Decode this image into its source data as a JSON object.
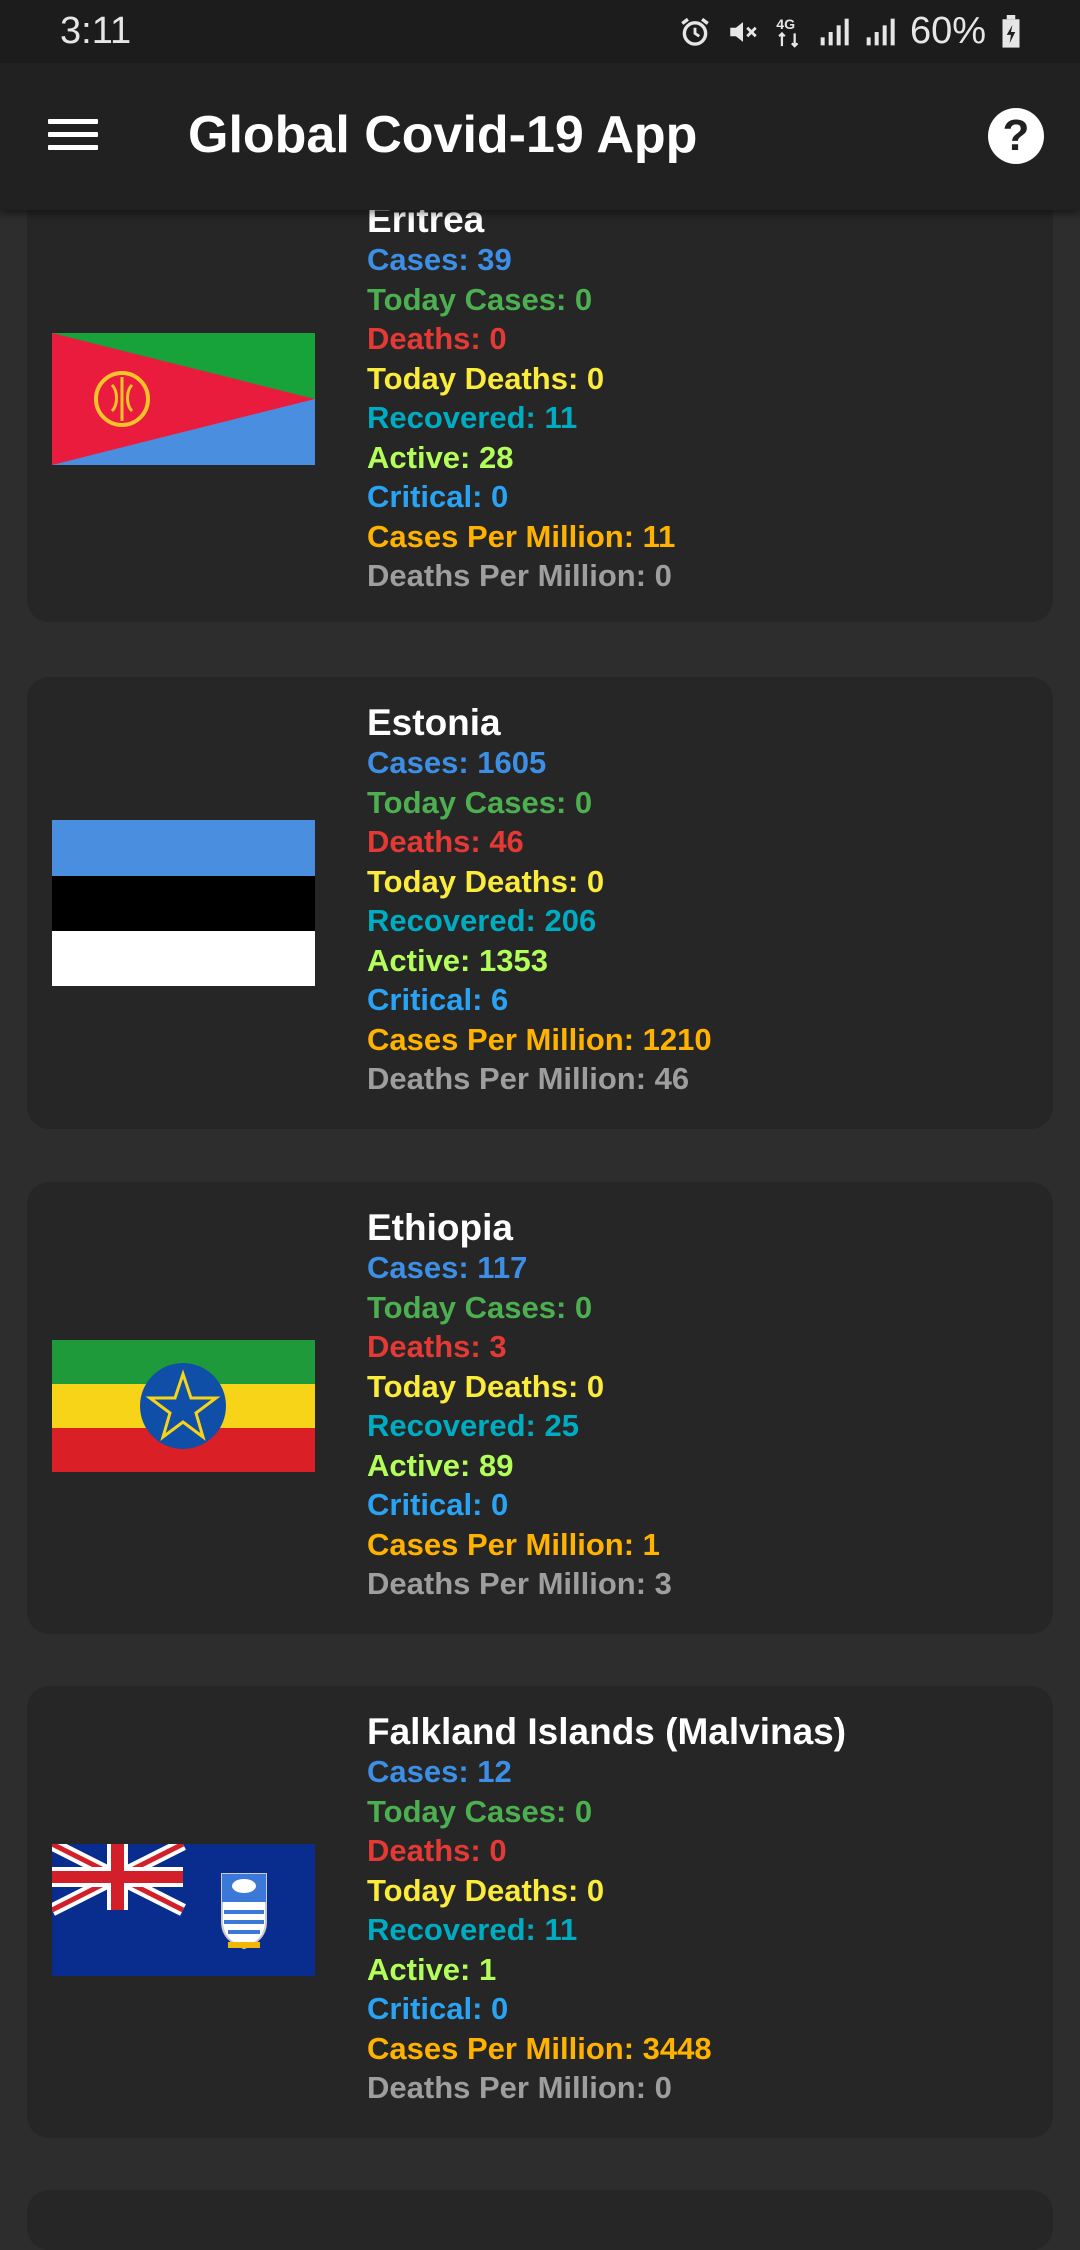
{
  "status_bar": {
    "time": "3:11",
    "battery": "60%",
    "network": "4G"
  },
  "app_bar": {
    "title": "Global Covid-19 App",
    "menu_icon": "menu-icon",
    "help_icon": "help-icon"
  },
  "labels": {
    "cases": "Cases: ",
    "today_cases": "Today Cases: ",
    "deaths": "Deaths: ",
    "today_deaths": "Today Deaths: ",
    "recovered": "Recovered: ",
    "active": "Active: ",
    "critical": "Critical: ",
    "cases_per_million": "Cases Per Million: ",
    "deaths_per_million": "Deaths Per Million: "
  },
  "countries": [
    {
      "name": "Eritrea",
      "cases": "39",
      "today_cases": "0",
      "deaths": "0",
      "today_deaths": "0",
      "recovered": "11",
      "active": "28",
      "critical": "0",
      "cases_per_million": "11",
      "deaths_per_million": "0"
    },
    {
      "name": "Estonia",
      "cases": "1605",
      "today_cases": "0",
      "deaths": "46",
      "today_deaths": "0",
      "recovered": "206",
      "active": "1353",
      "critical": "6",
      "cases_per_million": "1210",
      "deaths_per_million": "46"
    },
    {
      "name": "Ethiopia",
      "cases": "117",
      "today_cases": "0",
      "deaths": "3",
      "today_deaths": "0",
      "recovered": "25",
      "active": "89",
      "critical": "0",
      "cases_per_million": "1",
      "deaths_per_million": "3"
    },
    {
      "name": "Falkland Islands (Malvinas)",
      "cases": "12",
      "today_cases": "0",
      "deaths": "0",
      "today_deaths": "0",
      "recovered": "11",
      "active": "1",
      "critical": "0",
      "cases_per_million": "3448",
      "deaths_per_million": "0"
    }
  ],
  "colors": {
    "cases": "#3d8fe6",
    "today_cases": "#4caf50",
    "deaths": "#e53935",
    "today_deaths": "#fbeb3b",
    "recovered": "#00acc1",
    "active": "#b2ff59",
    "critical": "#29a3f3",
    "cases_per_million": "#ffb300",
    "deaths_per_million": "#9e9e9e"
  }
}
